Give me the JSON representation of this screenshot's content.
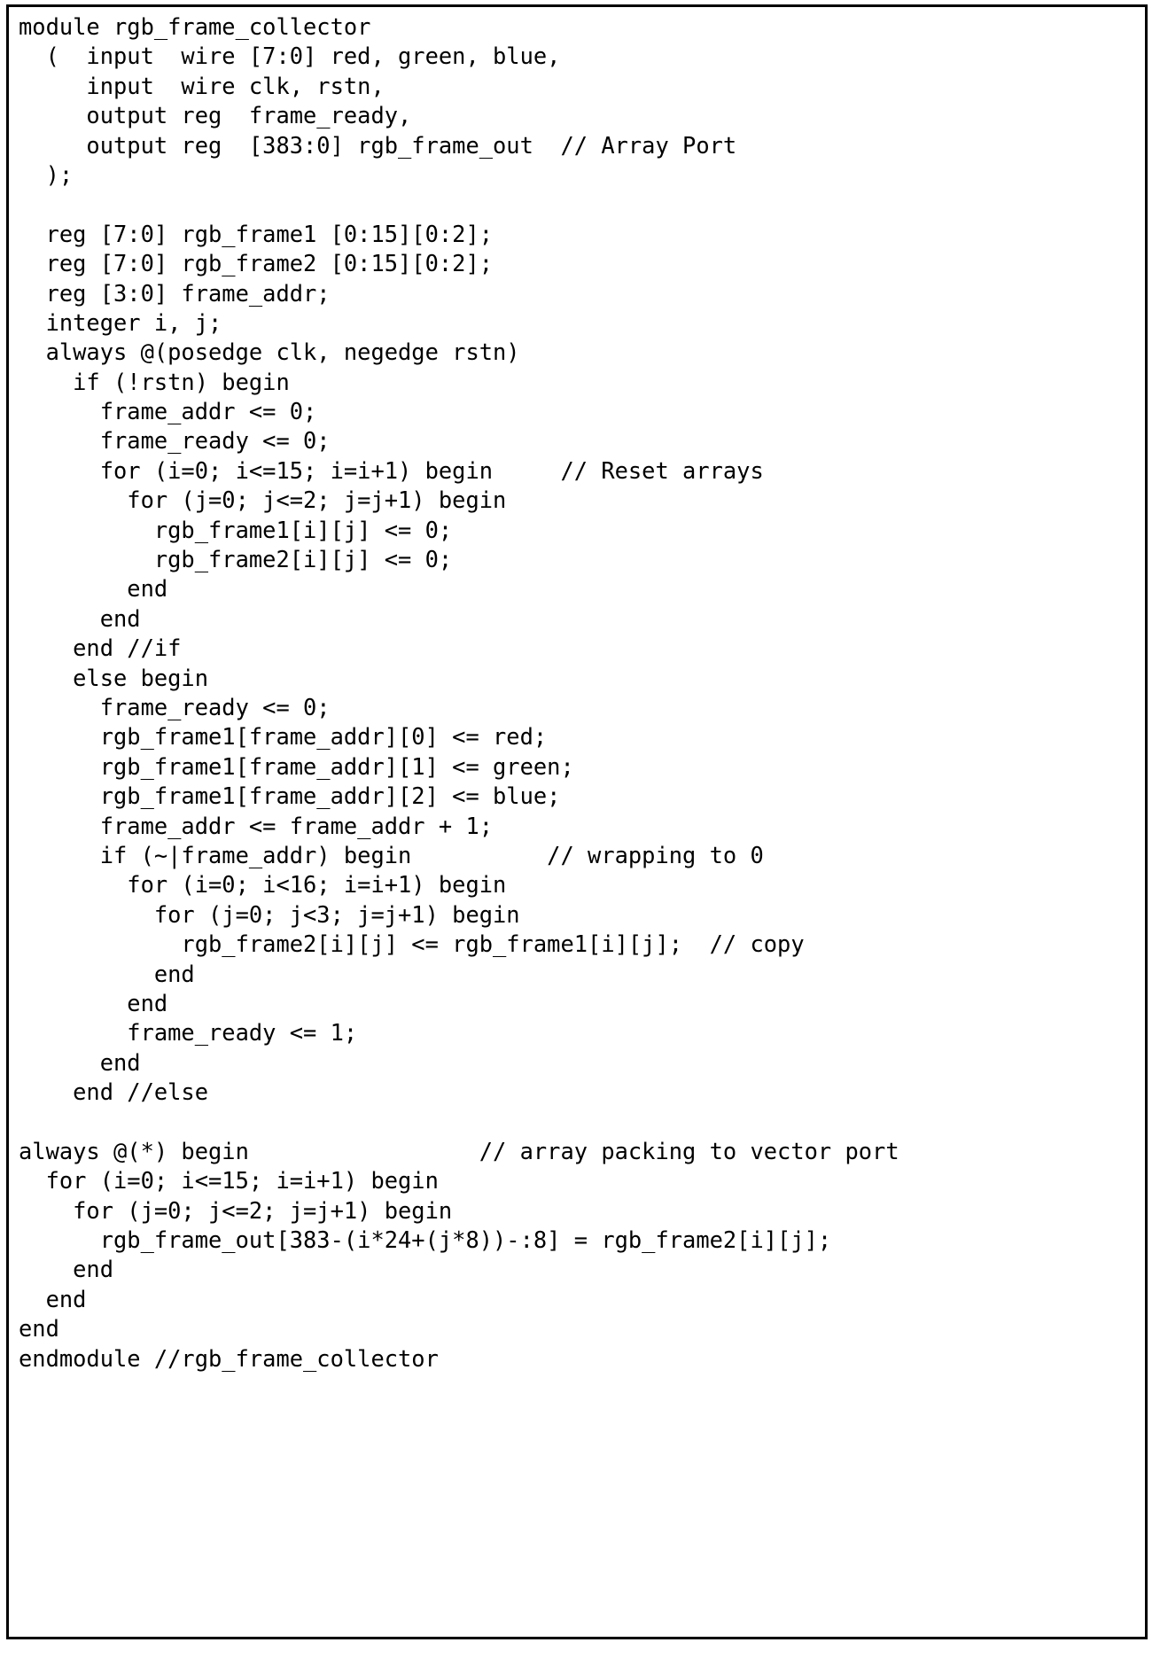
{
  "figure": {
    "kind": "code-listing",
    "language": "verilog",
    "module_name": "rgb_frame_collector",
    "border_color": "#000000",
    "background_color": "#ffffff",
    "text_color": "#000000"
  },
  "code": {
    "lines": [
      "module rgb_frame_collector",
      "  (  input  wire [7:0] red, green, blue,",
      "     input  wire clk, rstn,",
      "     output reg  frame_ready,",
      "     output reg  [383:0] rgb_frame_out  // Array Port",
      "  );",
      "",
      "  reg [7:0] rgb_frame1 [0:15][0:2];",
      "  reg [7:0] rgb_frame2 [0:15][0:2];",
      "  reg [3:0] frame_addr;",
      "  integer i, j;",
      "  always @(posedge clk, negedge rstn)",
      "    if (!rstn) begin",
      "      frame_addr <= 0;",
      "      frame_ready <= 0;",
      "      for (i=0; i<=15; i=i+1) begin     // Reset arrays",
      "        for (j=0; j<=2; j=j+1) begin",
      "          rgb_frame1[i][j] <= 0;",
      "          rgb_frame2[i][j] <= 0;",
      "        end",
      "      end",
      "    end //if",
      "    else begin",
      "      frame_ready <= 0;",
      "      rgb_frame1[frame_addr][0] <= red;",
      "      rgb_frame1[frame_addr][1] <= green;",
      "      rgb_frame1[frame_addr][2] <= blue;",
      "      frame_addr <= frame_addr + 1;",
      "      if (~|frame_addr) begin          // wrapping to 0",
      "        for (i=0; i<16; i=i+1) begin",
      "          for (j=0; j<3; j=j+1) begin",
      "            rgb_frame2[i][j] <= rgb_frame1[i][j];  // copy",
      "          end",
      "        end",
      "        frame_ready <= 1;",
      "      end",
      "    end //else",
      "",
      "always @(*) begin                 // array packing to vector port",
      "  for (i=0; i<=15; i=i+1) begin",
      "    for (j=0; j<=2; j=j+1) begin",
      "      rgb_frame_out[383-(i*24+(j*8))-:8] = rgb_frame2[i][j];",
      "    end",
      "  end",
      "end",
      "endmodule //rgb_frame_collector"
    ]
  }
}
